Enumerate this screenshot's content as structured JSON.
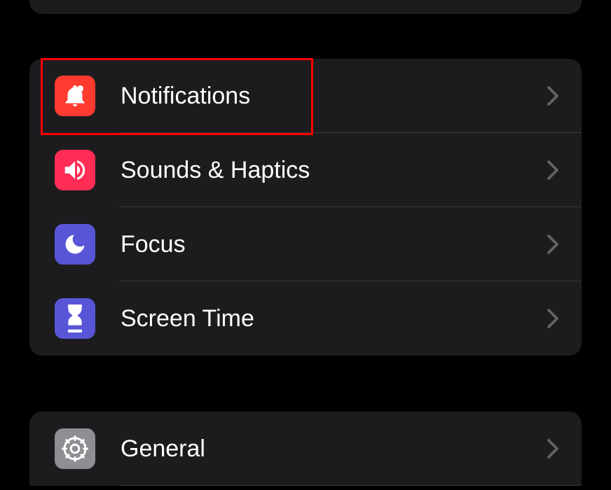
{
  "sections": {
    "middle": {
      "items": [
        {
          "label": "Notifications",
          "icon": "bell",
          "iconColor": "#ff3b30"
        },
        {
          "label": "Sounds & Haptics",
          "icon": "speaker",
          "iconColor": "#ff2d55"
        },
        {
          "label": "Focus",
          "icon": "moon",
          "iconColor": "#5856d6"
        },
        {
          "label": "Screen Time",
          "icon": "hourglass",
          "iconColor": "#5856d6"
        }
      ]
    },
    "bottom": {
      "items": [
        {
          "label": "General",
          "icon": "gear",
          "iconColor": "#8e8e93"
        }
      ]
    }
  },
  "highlightedItem": "Notifications"
}
